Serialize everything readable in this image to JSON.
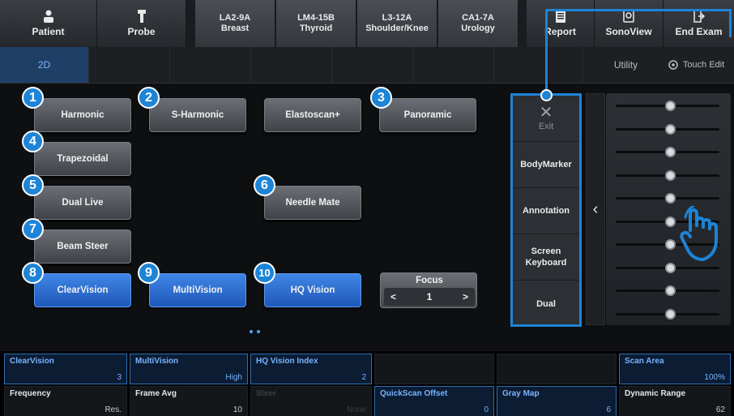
{
  "topbar": {
    "patient": "Patient",
    "probe": "Probe",
    "probes": [
      {
        "line1": "LA2-9A",
        "line2": "Breast"
      },
      {
        "line1": "LM4-15B",
        "line2": "Thyroid"
      },
      {
        "line1": "L3-12A",
        "line2": "Shoulder/Knee"
      },
      {
        "line1": "CA1-7A",
        "line2": "Urology"
      }
    ],
    "report": "Report",
    "sonoview": "SonoView",
    "end_exam": "End Exam"
  },
  "moderow": {
    "tab_2d": "2D",
    "utility": "Utility",
    "touch_edit": "Touch Edit"
  },
  "buttons": {
    "harmonic": "Harmonic",
    "s_harmonic": "S-Harmonic",
    "elastoscan": "Elastoscan+",
    "panoramic": "Panoramic",
    "trapezoidal": "Trapezoidal",
    "dual_live": "Dual Live",
    "needle_mate": "Needle Mate",
    "beam_steer": "Beam Steer",
    "clearvision": "ClearVision",
    "multivision": "MultiVision",
    "hq_vision": "HQ Vision"
  },
  "callouts": [
    "1",
    "2",
    "3",
    "4",
    "5",
    "6",
    "7",
    "8",
    "9",
    "10"
  ],
  "focus": {
    "title": "Focus",
    "value": "1",
    "prev": "<",
    "next": ">"
  },
  "side_panel": {
    "exit": "Exit",
    "bodymarker": "BodyMarker",
    "annotation": "Annotation",
    "screen_keyboard_1": "Screen",
    "screen_keyboard_2": "Keyboard",
    "dual": "Dual"
  },
  "tgc": {
    "slider_count": 10
  },
  "params": {
    "clearvision": {
      "label": "ClearVision",
      "value": "3"
    },
    "multivision": {
      "label": "MultiVision",
      "value": "High"
    },
    "hqindex": {
      "label": "HQ Vision Index",
      "value": "2"
    },
    "scanarea": {
      "label": "Scan Area",
      "value": "100%"
    },
    "frequency": {
      "label": "Frequency",
      "value": "Res."
    },
    "frameavg": {
      "label": "Frame Avg",
      "value": "10"
    },
    "steer": {
      "label": "Steer",
      "value": "None"
    },
    "quickscan": {
      "label": "QuickScan Offset",
      "value": "0"
    },
    "graymap": {
      "label": "Gray Map",
      "value": "6"
    },
    "dynrange": {
      "label": "Dynamic Range",
      "value": "62"
    }
  },
  "colors": {
    "accent": "#1d84d6",
    "active_button": "#2f6fd4"
  }
}
